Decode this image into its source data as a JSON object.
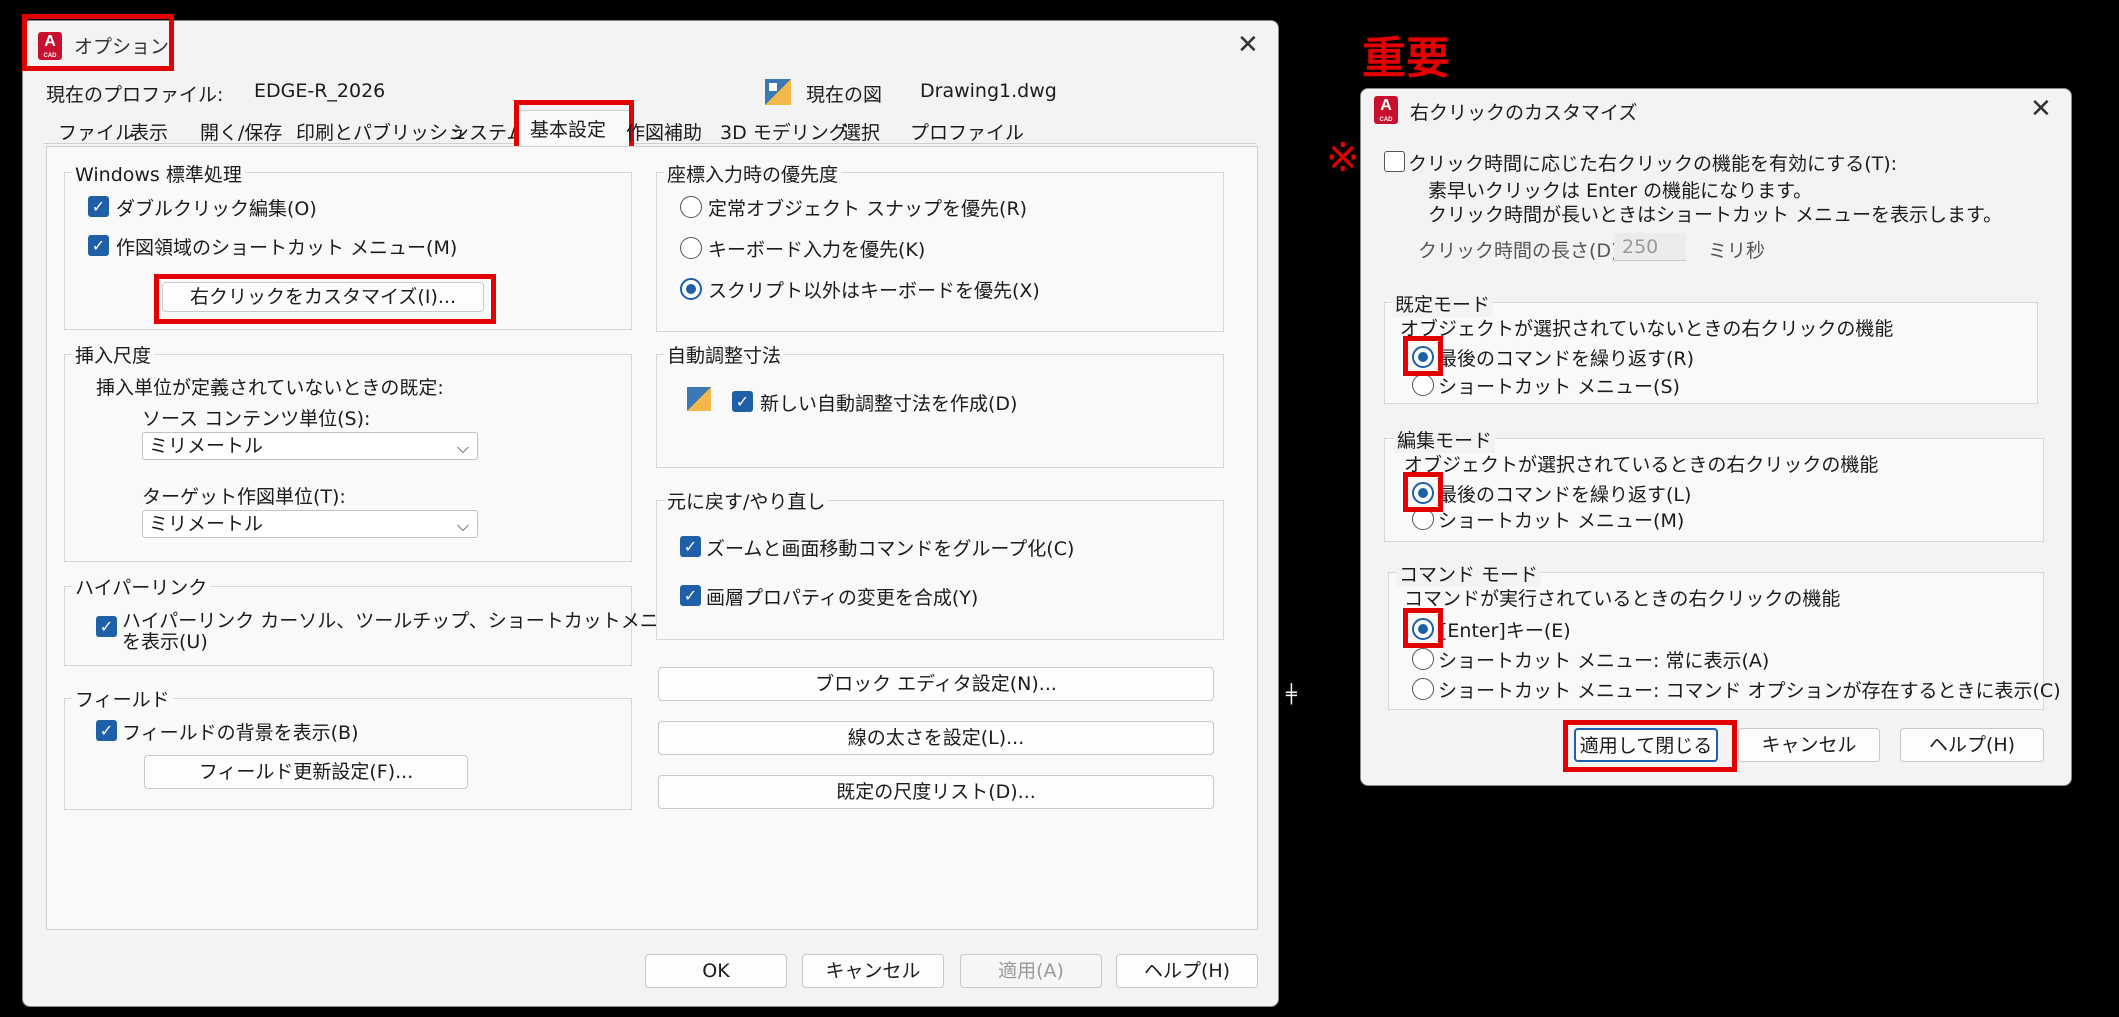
{
  "options_dialog": {
    "title": "オプション",
    "profile_label": "現在のプロファイル:",
    "profile_value": "EDGE-R_2026",
    "drawing_label": "現在の図",
    "drawing_value": "Drawing1.dwg",
    "tabs": [
      "ファイル",
      "表示",
      "開く/保存",
      "印刷とパブリッシュ",
      "システム",
      "基本設定",
      "作図補助",
      "3D モデリング",
      "選択",
      "プロファイル"
    ],
    "active_tab": "基本設定",
    "windows_group": {
      "title": "Windows 標準処理",
      "double_click": "ダブルクリック編集(O)",
      "shortcut_menu": "作図領域のショートカット メニュー(M)",
      "customize_button": "右クリックをカスタマイズ(I)..."
    },
    "insert_group": {
      "title": "挿入尺度",
      "desc": "挿入単位が定義されていないときの既定:",
      "source_label": "ソース コンテンツ単位(S):",
      "source_value": "ミリメートル",
      "target_label": "ターゲット作図単位(T):",
      "target_value": "ミリメートル"
    },
    "hyperlink_group": {
      "title": "ハイパーリンク",
      "line1": "ハイパーリンク カーソル、ツールチップ、ショートカットメニュー",
      "line2": "を表示(U)"
    },
    "field_group": {
      "title": "フィールド",
      "show_bg": "フィールドの背景を表示(B)",
      "update_button": "フィールド更新設定(F)..."
    },
    "coord_group": {
      "title": "座標入力時の優先度",
      "opt1": "定常オブジェクト スナップを優先(R)",
      "opt2": "キーボード入力を優先(K)",
      "opt3": "スクリプト以外はキーボードを優先(X)"
    },
    "assoc_group": {
      "title": "自動調整寸法",
      "create": "新しい自動調整寸法を作成(D)"
    },
    "undo_group": {
      "title": "元に戻す/やり直し",
      "zoom_pan": "ズームと画面移動コマンドをグループ化(C)",
      "layer_props": "画層プロパティの変更を合成(Y)"
    },
    "block_editor_button": "ブロック エディタ設定(N)...",
    "lineweight_button": "線の太さを設定(L)...",
    "scale_list_button": "既定の尺度リスト(D)...",
    "ok": "OK",
    "cancel": "キャンセル",
    "apply": "適用(A)",
    "help": "ヘルプ(H)"
  },
  "annotation": {
    "important": "重要",
    "mark": "※"
  },
  "right_click_dialog": {
    "title": "右クリックのカスタマイズ",
    "time_sensitive": "クリック時間に応じた右クリックの機能を有効にする(T):",
    "desc1": "素早いクリックは Enter の機能になります。",
    "desc2": "クリック時間が長いときはショートカット メニューを表示します。",
    "duration_label": "クリック時間の長さ(D):",
    "duration_value": "250",
    "duration_unit": "ミリ秒",
    "default_mode": {
      "title": "既定モード",
      "desc": "オブジェクトが選択されていないときの右クリックの機能",
      "opt1": "最後のコマンドを繰り返す(R)",
      "opt2": "ショートカット メニュー(S)"
    },
    "edit_mode": {
      "title": "編集モード",
      "desc": "オブジェクトが選択されているときの右クリックの機能",
      "opt1": "最後のコマンドを繰り返す(L)",
      "opt2": "ショートカット メニュー(M)"
    },
    "command_mode": {
      "title": "コマンド モード",
      "desc": "コマンドが実行されているときの右クリックの機能",
      "opt1": "[Enter]キー(E)",
      "opt2": "ショートカット メニュー: 常に表示(A)",
      "opt3": "ショートカット メニュー: コマンド オプションが存在するときに表示(C)"
    },
    "apply_close": "適用して閉じる",
    "cancel": "キャンセル",
    "help": "ヘルプ(H)"
  },
  "colors": {
    "highlight": "#e30000",
    "check": "#1f5fa8",
    "app_icon": "#c8102e"
  }
}
